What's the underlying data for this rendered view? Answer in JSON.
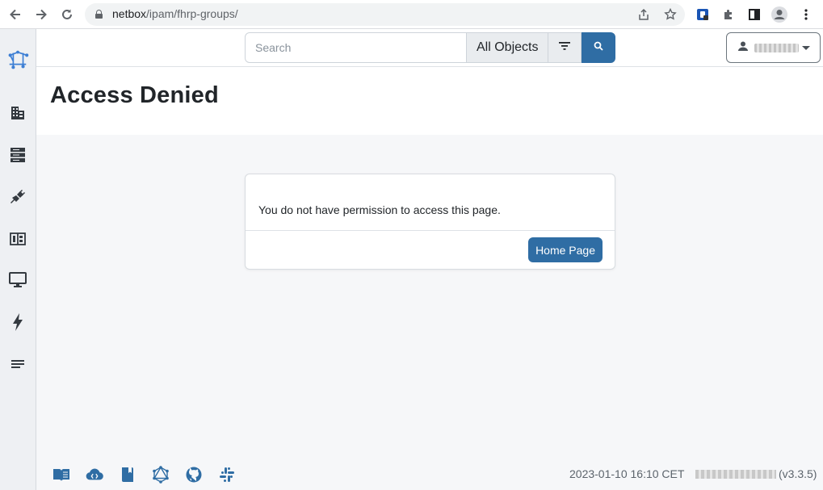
{
  "browser": {
    "url_host": "netbox",
    "url_path": "/ipam/fhrp-groups/"
  },
  "sidebar": {
    "items": [
      {
        "icon": "netbox-logo-icon"
      },
      {
        "icon": "organization-icon"
      },
      {
        "icon": "devices-icon"
      },
      {
        "icon": "connections-icon"
      },
      {
        "icon": "ipam-icon"
      },
      {
        "icon": "virtualization-icon"
      },
      {
        "icon": "power-icon"
      },
      {
        "icon": "other-icon"
      }
    ]
  },
  "header": {
    "search_placeholder": "Search",
    "search_scope": "All Objects"
  },
  "page": {
    "title": "Access Denied"
  },
  "card": {
    "message": "You do not have permission to access this page.",
    "button_label": "Home Page"
  },
  "footer": {
    "timestamp": "2023-01-10 16:10 CET",
    "version": "(v3.3.5)",
    "icons": [
      "docs-icon",
      "api-icon",
      "api-docs-icon",
      "graphql-icon",
      "github-icon",
      "slack-icon"
    ]
  },
  "colors": {
    "accent": "#2f6da4",
    "sidebar_bg": "#eef0f3",
    "content_bg": "#f6f7f9"
  }
}
